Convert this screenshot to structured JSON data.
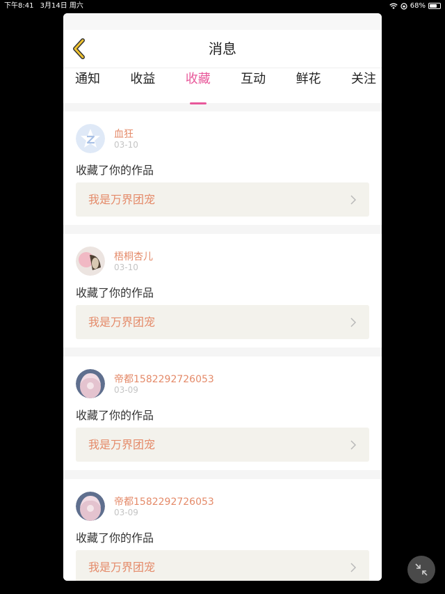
{
  "status_bar": {
    "time": "下午8:41",
    "date": "3月14日 周六",
    "battery": "68%",
    "battery_level": 0.68
  },
  "header": {
    "title": "消息"
  },
  "tabs": [
    {
      "label": "通知"
    },
    {
      "label": "收益"
    },
    {
      "label": "收藏",
      "active": true
    },
    {
      "label": "互动"
    },
    {
      "label": "鲜花"
    },
    {
      "label": "关注"
    }
  ],
  "messages": [
    {
      "username": "血狂",
      "date": "03-10",
      "action": "收藏了你的作品",
      "work": "我是万界团宠",
      "avatar": "default-q-avatar"
    },
    {
      "username": "梧桐杏儿",
      "date": "03-10",
      "action": "收藏了你的作品",
      "work": "我是万界团宠",
      "avatar": "photo-avatar"
    },
    {
      "username": "帝都1582292726053",
      "date": "03-09",
      "action": "收藏了你的作品",
      "work": "我是万界团宠",
      "avatar": "photo-avatar"
    },
    {
      "username": "帝都1582292726053",
      "date": "03-09",
      "action": "收藏了你的作品",
      "work": "我是万界团宠",
      "avatar": "photo-avatar"
    }
  ],
  "colors": {
    "accent": "#e8589a",
    "name": "#e48a69",
    "back_icon": "#f0c330"
  }
}
